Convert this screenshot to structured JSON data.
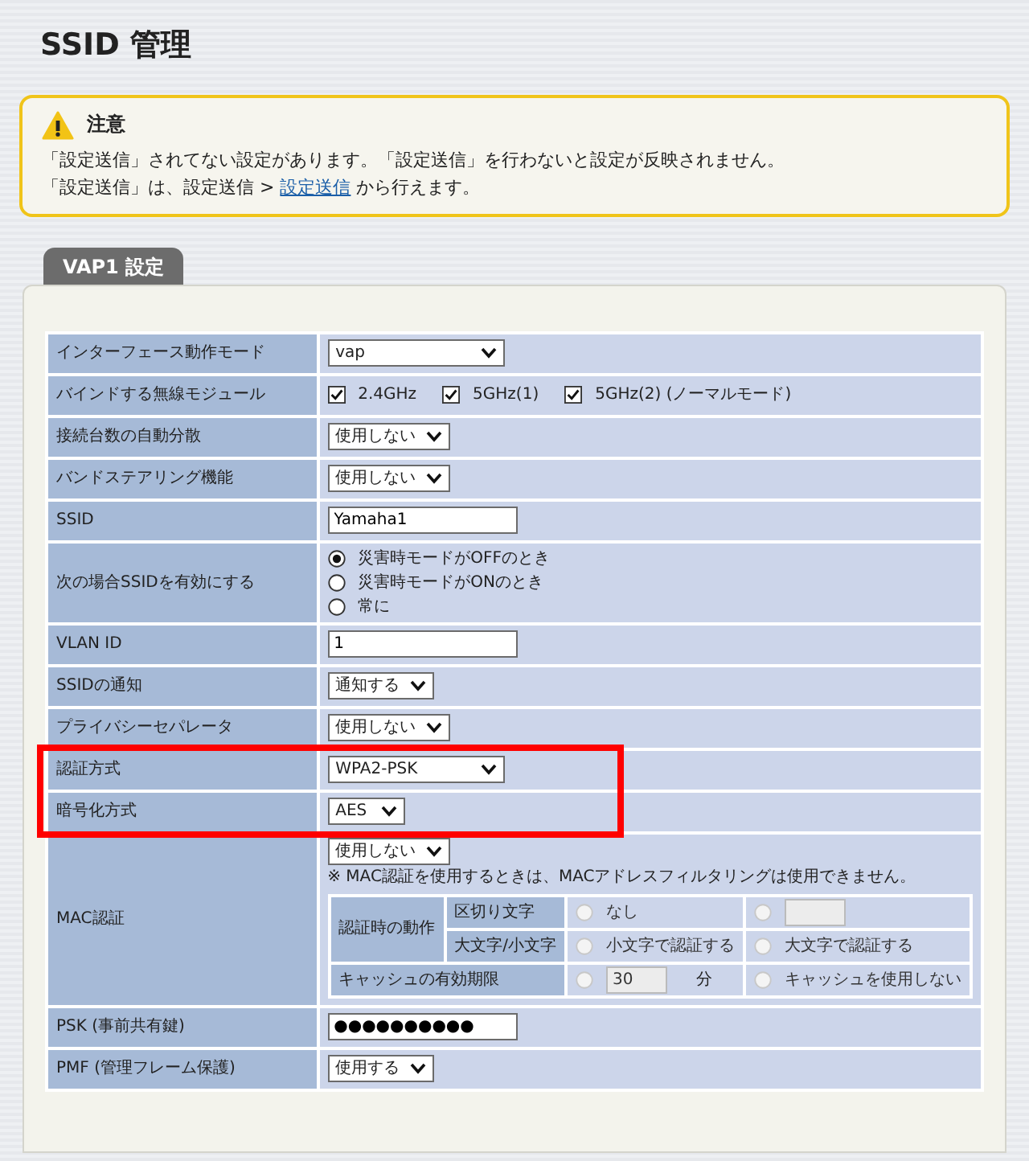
{
  "title": "SSID 管理",
  "notice": {
    "heading": "注意",
    "line1": "「設定送信」されてない設定があります。「設定送信」を行わないと設定が反映されません。",
    "line2": {
      "before": "「設定送信」は、設定送信 > ",
      "link": "設定送信",
      "after": " から行えます。"
    }
  },
  "tab": {
    "label": "VAP1 設定"
  },
  "rows": [
    {
      "label": "インターフェース動作モード",
      "kind": "select",
      "value": "vap",
      "highlighted": false
    },
    {
      "label": "バインドする無線モジュール",
      "kind": "checks",
      "highlighted": false,
      "items": [
        {
          "label": "2.4GHz",
          "checked": true
        },
        {
          "label": "5GHz(1)",
          "checked": true
        },
        {
          "label": "5GHz(2) (ノーマルモード)",
          "checked": true
        }
      ]
    },
    {
      "label": "接続台数の自動分散",
      "kind": "select",
      "value": "使用しない",
      "highlighted": false
    },
    {
      "label": "バンドステアリング機能",
      "kind": "select",
      "value": "使用しない",
      "highlighted": false
    },
    {
      "label": "SSID",
      "kind": "text",
      "value": "Yamaha1",
      "highlighted": false
    },
    {
      "label": "次の場合SSIDを有効にする",
      "kind": "radios",
      "highlighted": false,
      "items": [
        {
          "label": "災害時モードがOFFのとき",
          "selected": true
        },
        {
          "label": "災害時モードがONのとき",
          "selected": false
        },
        {
          "label": "常に",
          "selected": false
        }
      ]
    },
    {
      "label": "VLAN ID",
      "kind": "text",
      "value": "1",
      "highlighted": false
    },
    {
      "label": "SSIDの通知",
      "kind": "select",
      "value": "通知する",
      "highlighted": false
    },
    {
      "label": "プライバシーセパレータ",
      "kind": "select",
      "value": "使用しない",
      "highlighted": false
    },
    {
      "label": "認証方式",
      "kind": "select",
      "value": "WPA2-PSK",
      "highlighted": true
    },
    {
      "label": "暗号化方式",
      "kind": "select",
      "value": "AES",
      "highlighted": true
    },
    {
      "label": "MAC認証",
      "kind": "mac",
      "value": "使用しない",
      "highlighted": false,
      "note": "※ MAC認証を使用するときは、MACアドレスフィルタリングは使用できません。",
      "sub": {
        "group": "認証時の動作",
        "rows": [
          {
            "label": "区切り文字",
            "options": [
              {
                "kind": "text",
                "label": "なし",
                "selected": false,
                "disabled": true
              },
              {
                "kind": "field",
                "selected": false,
                "disabled": true
              }
            ]
          },
          {
            "label": "大文字/小文字",
            "options": [
              {
                "kind": "text",
                "label": "小文字で認証する",
                "selected": false,
                "disabled": true
              },
              {
                "kind": "text",
                "label": "大文字で認証する",
                "selected": false,
                "disabled": true
              }
            ]
          }
        ],
        "cache": {
          "label": "キャッシュの有効期限",
          "options": [
            {
              "kind": "field",
              "value": "30",
              "unit": "分",
              "selected": false,
              "disabled": true
            },
            {
              "kind": "text",
              "label": "キャッシュを使用しない",
              "selected": false,
              "disabled": true
            }
          ]
        }
      }
    },
    {
      "label": "PSK (事前共有鍵)",
      "kind": "text",
      "value": "●●●●●●●●●●",
      "highlighted": false
    },
    {
      "label": "PMF (管理フレーム保護)",
      "kind": "select",
      "value": "使用する",
      "highlighted": false
    }
  ]
}
